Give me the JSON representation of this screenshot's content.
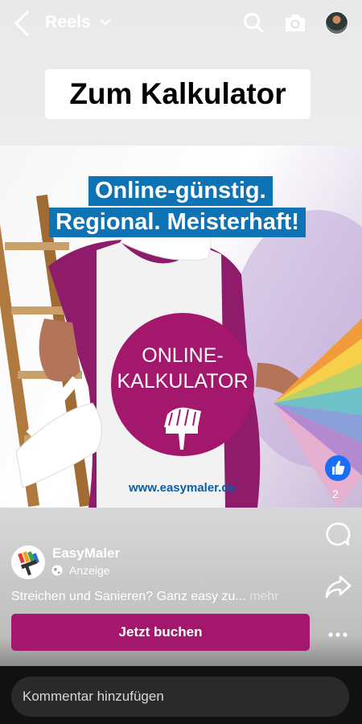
{
  "topbar": {
    "title": "Reels",
    "icons": [
      "back-arrow-icon",
      "chevron-down-icon",
      "search-icon",
      "camera-icon",
      "profile-avatar"
    ]
  },
  "headline": "Zum Kalkulator",
  "ad_image": {
    "tag_line_1": "Online-günstig.",
    "tag_line_2": "Regional. Meisterhaft!",
    "circle_line_1": "ONLINE-",
    "circle_line_2": "KALKULATOR",
    "url": "www.easymaler.de",
    "colors": {
      "brand_magenta": "#a3176c",
      "tag_blue": "#0e73b4"
    }
  },
  "actions": {
    "like_count": "2",
    "icons": [
      "like-icon",
      "comment-icon",
      "share-icon",
      "more-icon"
    ],
    "like_color": "#1a6ef5"
  },
  "sponsor": {
    "name": "EasyMaler",
    "label": "Anzeige"
  },
  "caption": {
    "text": "Streichen und Sanieren? Ganz easy zu...",
    "more": "mehr"
  },
  "cta": {
    "label": "Jetzt buchen"
  },
  "comment": {
    "placeholder": "Kommentar hinzufügen"
  }
}
